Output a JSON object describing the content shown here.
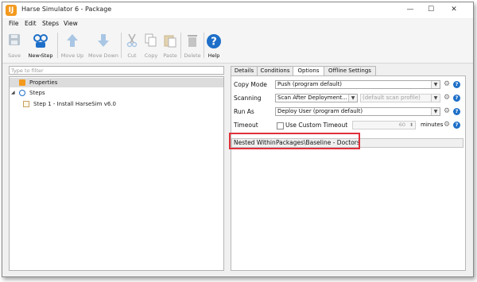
{
  "window": {
    "title": "Harse Simulator 6 - Package",
    "app_icon_letter": "IJ",
    "controls": {
      "minimize": "—",
      "maximize": "☐",
      "close": "✕"
    }
  },
  "menu": [
    "File",
    "Edit",
    "Steps",
    "View"
  ],
  "toolbar": {
    "save": "Save",
    "new_step": "New Step",
    "move_up": "Move Up",
    "move_down": "Move Down",
    "cut": "Cut",
    "copy": "Copy",
    "paste": "Paste",
    "delete": "Delete",
    "help": "Help"
  },
  "filter": {
    "placeholder": "Type to filter"
  },
  "tree": {
    "properties": "Properties",
    "steps": "Steps",
    "step1": "Step 1 - Install HarseSim v6.0"
  },
  "tabs": [
    "Details",
    "Conditions",
    "Options",
    "Offline Settings"
  ],
  "options": {
    "copy_mode_label": "Copy Mode",
    "copy_mode_value": "Push (program default)",
    "scanning_label": "Scanning",
    "scanning_value": "Scan After Deployment...",
    "scan_profile_placeholder": "(default scan profile)",
    "run_as_label": "Run As",
    "run_as_value": "Deploy User (program default)",
    "timeout_label": "Timeout",
    "use_custom_timeout": "Use Custom Timeout",
    "timeout_value": "60",
    "timeout_unit": "minutes",
    "nested_within_label": "Nested Within",
    "nested_within_value": "Packages\\Baseline - Doctors"
  },
  "colors": {
    "accent_blue": "#1e6fc8",
    "highlight_red": "#e0303a",
    "app_orange": "#f39a1e"
  }
}
